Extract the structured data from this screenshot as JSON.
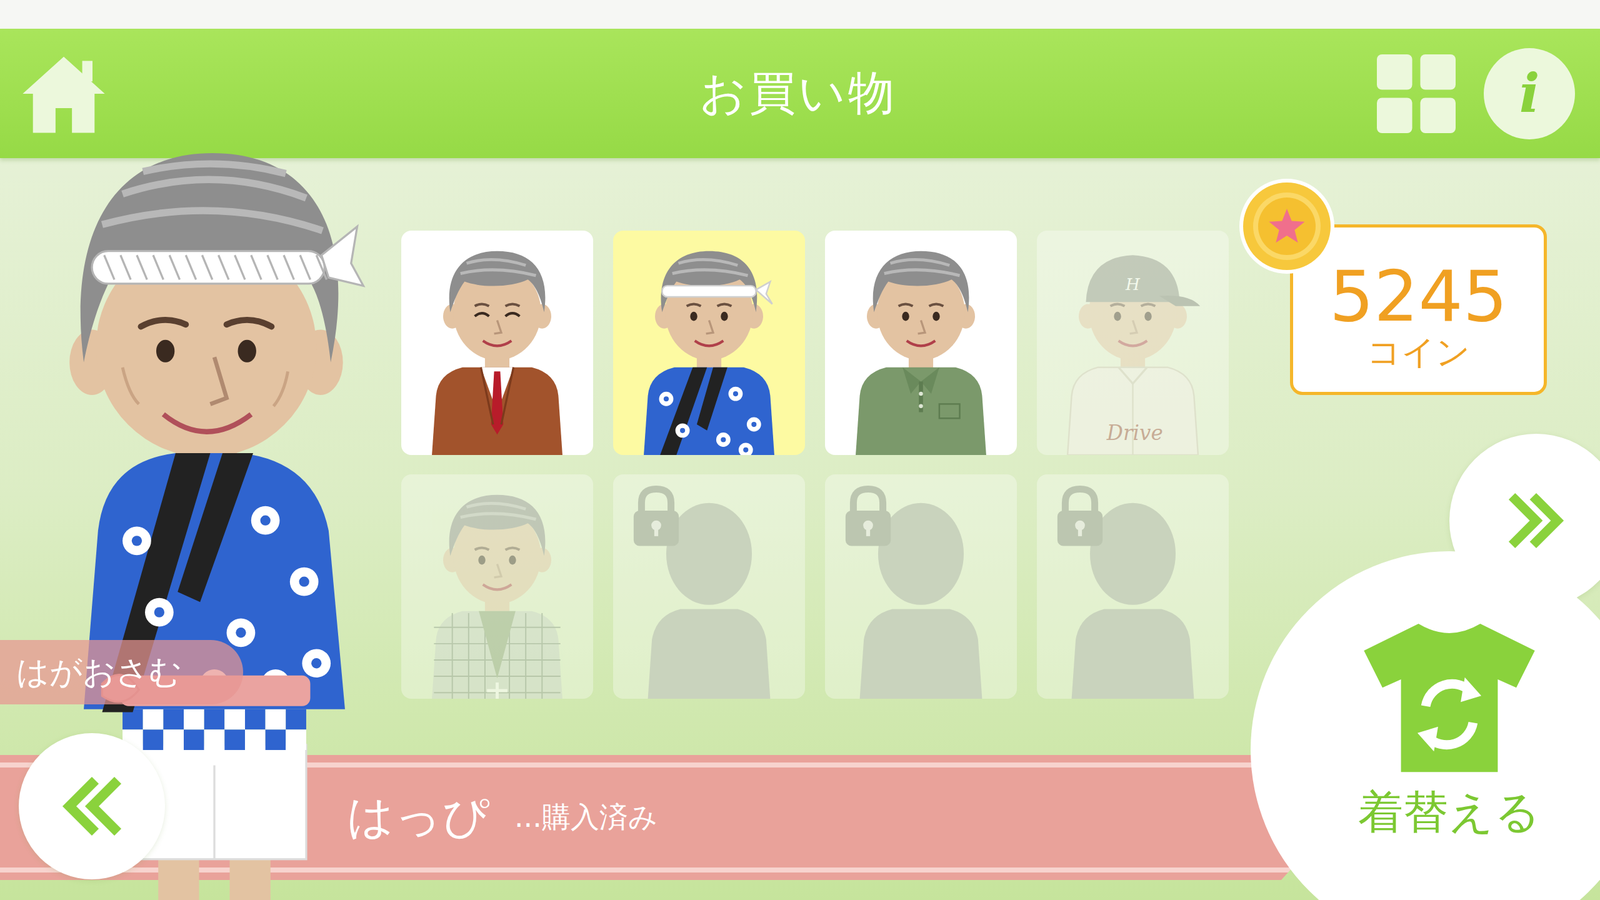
{
  "header": {
    "title": "お買い物",
    "info_label": "i"
  },
  "player": {
    "name": "はがおさむ"
  },
  "wallet": {
    "amount": "5245",
    "unit": "コイン"
  },
  "items": [
    {
      "kind": "suit",
      "owned": true,
      "locked": false,
      "selected": false
    },
    {
      "kind": "happi",
      "owned": true,
      "locked": false,
      "selected": true
    },
    {
      "kind": "polo",
      "owned": true,
      "locked": false,
      "selected": false
    },
    {
      "kind": "baseball",
      "owned": false,
      "locked": false,
      "selected": false,
      "cap_text": "H",
      "jersey_text": "Drive"
    },
    {
      "kind": "kimono",
      "owned": false,
      "locked": false,
      "selected": false
    },
    {
      "kind": "silhouette",
      "owned": false,
      "locked": true,
      "selected": false
    },
    {
      "kind": "silhouette",
      "owned": false,
      "locked": true,
      "selected": false
    },
    {
      "kind": "silhouette",
      "owned": false,
      "locked": true,
      "selected": false
    }
  ],
  "selection": {
    "name": "はっぴ",
    "status": "...購入済み"
  },
  "change_button": {
    "label": "着替える"
  }
}
